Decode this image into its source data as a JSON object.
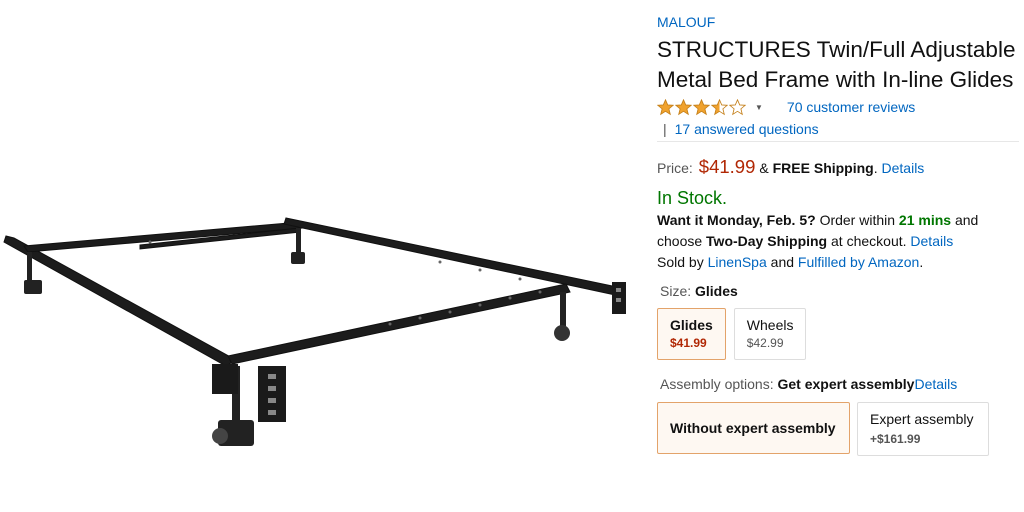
{
  "product": {
    "brand": "MALOUF",
    "title": "STRUCTURES Twin/Full Adjustable Metal Bed Frame with In-line Glides",
    "image_icon": "bed-frame-image"
  },
  "rating": {
    "stars": 3.5,
    "reviews_label": "70 customer reviews",
    "qa_separator": "|",
    "answered_label": "17 answered questions"
  },
  "price": {
    "label": "Price:",
    "value": "$41.99",
    "amp": "&",
    "shipping": "FREE Shipping",
    "dot": ".",
    "details": "Details"
  },
  "stock": {
    "status": "In Stock."
  },
  "delivery": {
    "want_it": "Want it Monday, Feb. 5?",
    "order_within": "Order within",
    "time_left": "21 mins",
    "and": "and",
    "choose": "choose",
    "two_day": "Two-Day Shipping",
    "at_checkout": "at checkout.",
    "details": "Details",
    "sold_by": "Sold by",
    "seller": "LinenSpa",
    "and2": "and",
    "fulfilled": "Fulfilled by Amazon",
    "period": "."
  },
  "size": {
    "label": "Size:",
    "selected": "Glides",
    "options": [
      {
        "name": "Glides",
        "price": "$41.99"
      },
      {
        "name": "Wheels",
        "price": "$42.99"
      }
    ]
  },
  "assembly": {
    "label": "Assembly options:",
    "selected": "Get expert assembly",
    "details": "Details",
    "options": [
      {
        "name": "Without expert assembly"
      },
      {
        "name": "Expert assembly",
        "price": "+$161.99"
      }
    ]
  },
  "colors": {
    "link": "#0066c0",
    "price": "#b12704",
    "in_stock": "#007600",
    "star": "#f0a22e",
    "selected_border": "#e3a36a"
  }
}
